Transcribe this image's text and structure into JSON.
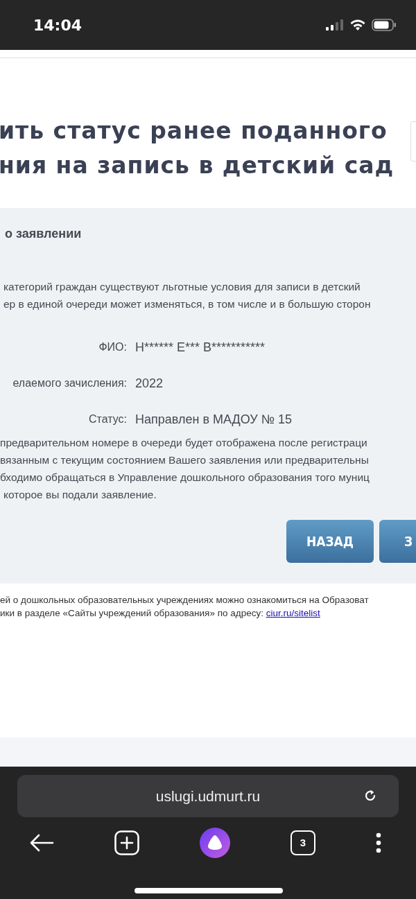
{
  "status_bar": {
    "time": "14:04"
  },
  "page": {
    "title_lines": [
      "ить статус ранее поданного",
      "ния на запись в детский сад"
    ],
    "panel": {
      "heading": "о заявлении",
      "note_lines": [
        "категорий граждан существуют льготные условия для записи в детский",
        "ер в единой очереди может изменяться, в том числе и в большую сторон"
      ],
      "fields": [
        {
          "label": "ФИО:",
          "value": "Н****** Е*** В***********"
        },
        {
          "label": "елаемого зачисления:",
          "value": "2022"
        },
        {
          "label": "Статус:",
          "value": "Направлен в МАДОУ № 15"
        }
      ],
      "info_lines": [
        "предварительном номере в очереди будет отображена после регистраци",
        "вязанным с текущим состоянием Вашего заявления или предварительны",
        "бходимо обращаться в Управление дошкольного образования того муниц",
        "которое вы подали заявление."
      ],
      "buttons": [
        "НАЗАД",
        "З"
      ]
    },
    "footer": {
      "lines": [
        {
          "text": "ей о дошкольных образовательных учреждениях можно ознакомиться на Образоват"
        },
        {
          "text": "ики в разделе «Сайты учреждений образования» по адресу: ",
          "link": "ciur.ru/sitelist"
        }
      ]
    }
  },
  "browser": {
    "url": "uslugi.udmurt.ru",
    "tab_count": "3"
  }
}
